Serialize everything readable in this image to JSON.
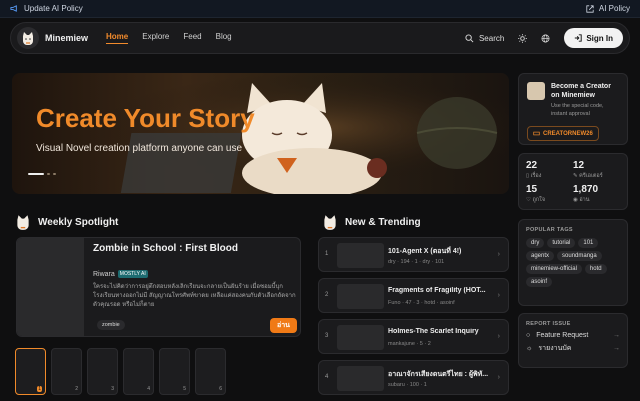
{
  "topbar": {
    "notice": "Update AI Policy",
    "link": "AI Policy"
  },
  "nav": {
    "brand": "Minemiew",
    "items": [
      "Home",
      "Explore",
      "Feed",
      "Blog"
    ],
    "search_label": "Search",
    "signin_label": "Sign In"
  },
  "hero": {
    "title": "Create Your Story",
    "subtitle": "Visual Novel creation platform anyone can use"
  },
  "creator": {
    "title": "Become a Creator on Minemiew",
    "desc": "Use the special code, instant approval",
    "code": "CREATORNEW26"
  },
  "stats": [
    {
      "num": "22",
      "label": "เรื่อง"
    },
    {
      "num": "12",
      "label": "ครีเอเตอร์"
    },
    {
      "num": "15",
      "label": "ถูกใจ"
    },
    {
      "num": "1,870",
      "label": "อ่าน"
    }
  ],
  "tags": {
    "title": "POPULAR TAGS",
    "items": [
      "dry",
      "tutorial",
      "101",
      "agentx",
      "soundmanga",
      "minemiew-official",
      "hotd",
      "asoinf"
    ]
  },
  "report": {
    "title": "REPORT ISSUE",
    "items": [
      "Feature Request",
      "รายงานบัค"
    ]
  },
  "spotlight": {
    "section_title": "Weekly Spotlight",
    "title": "Zombie in School : First Blood",
    "author": "Riwara",
    "ai_badge": "MOSTLY AI",
    "desc": "ใครจะไปคิดว่าการอยู่ตึกสอบหลังเลิกเรียนจะกลายเป็นฝันร้าย เมื่อซอมบี้บุกโรงเรียนทางออกไม่มี สัญญาณโทรศัพท์ขาดย เหลือแค่สองคนกับตัวเลือกถัดจากตัวคุณรอด หรือไม่ก็ตาย",
    "tag": "zombie",
    "read_label": "อ่าน",
    "thumbs": [
      "1",
      "2",
      "3",
      "4",
      "5",
      "6"
    ]
  },
  "trending": {
    "section_title": "New & Trending",
    "items": [
      {
        "rank": "1",
        "title": "101-Agent X (ตอนที่ 4!)",
        "meta": "dry · 194 · 1 · dry · 101"
      },
      {
        "rank": "2",
        "title": "Fragments of Fragility (HOT...",
        "meta": "Funo · 47 · 3 · hotd · asoinf"
      },
      {
        "rank": "3",
        "title": "Holmes-The Scarlet Inquiry",
        "meta": "mankajune · 5 · 2"
      },
      {
        "rank": "4",
        "title": "อาณาจักรเสียงดนตรีไทย : ผู้พิทั...",
        "meta": "subaru · 100 · 1"
      }
    ]
  }
}
